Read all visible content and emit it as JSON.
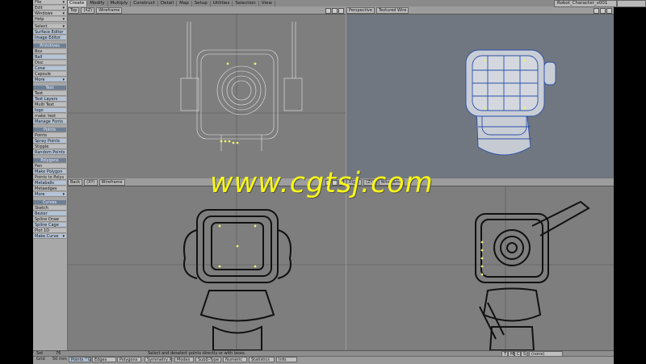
{
  "tabs": [
    "Create",
    "Modify",
    "Multiply",
    "Construct",
    "Detail",
    "Map",
    "Setup",
    "Utilities",
    "Selection",
    "View"
  ],
  "active_tab": "Create",
  "scene_name": "Robot_Character_v001",
  "toolbar": {
    "top": [
      "File",
      "Edit",
      "Windows",
      "Help"
    ],
    "select_group": [
      "Select",
      "Surface Editor",
      "Image Editor"
    ],
    "sections": [
      {
        "title": "Primitives",
        "items": [
          "Box",
          "Ball",
          "Disc",
          "Cone",
          "Capsule",
          "More"
        ]
      },
      {
        "title": "Text",
        "items": [
          "Text",
          "Text Layers",
          "Multi Text",
          "logo",
          "make_text",
          "Manage Fonts"
        ]
      },
      {
        "title": "Points",
        "items": [
          "Points",
          "Spray Points",
          "Stipple",
          "Random Points"
        ]
      },
      {
        "title": "Polygons",
        "items": [
          "Pen",
          "Make Polygon",
          "Points to Polys",
          "Metaballs",
          "Metaedges",
          "More"
        ]
      },
      {
        "title": "Curves",
        "items": [
          "Sketch",
          "Bezier",
          "Spline Draw",
          "Spline Cage",
          "Plot 1D",
          "Make Curve"
        ]
      }
    ]
  },
  "viewports": [
    {
      "view": "Top",
      "axis": "(XZ)",
      "mode": "Wireframe"
    },
    {
      "view": "Perspective",
      "axis": "",
      "mode": "Textured Wire"
    },
    {
      "view": "Back",
      "axis": "(XY)",
      "mode": "Wireframe"
    },
    {
      "view": "Right",
      "axis": "(ZY)",
      "mode": "Wireframe"
    }
  ],
  "status": {
    "set_label": "Set",
    "set_value": "76",
    "message": "Select and deselect points directly or with lasso.",
    "grid_label": "Grid",
    "grid_value": "50 mm",
    "mode_buttons": [
      "Points",
      "Edges",
      "Polygons"
    ],
    "points_shortcut": "^G",
    "symmetry": "Symmetry",
    "symmetry_axis": "X",
    "modes": "Modes",
    "subd": "SubD-Type",
    "numeric": "Numeric",
    "statistics": "Statistics",
    "info": "Info",
    "layer_buttons": [
      "T",
      "M",
      "C",
      "S"
    ],
    "layer_value": "(none)"
  },
  "watermark": "www.cgtsj.com",
  "colors": {
    "accent": "#6d7f94",
    "watermark": "#f7f718",
    "model_lines": "#000000",
    "selected_points": "#f0f070"
  }
}
